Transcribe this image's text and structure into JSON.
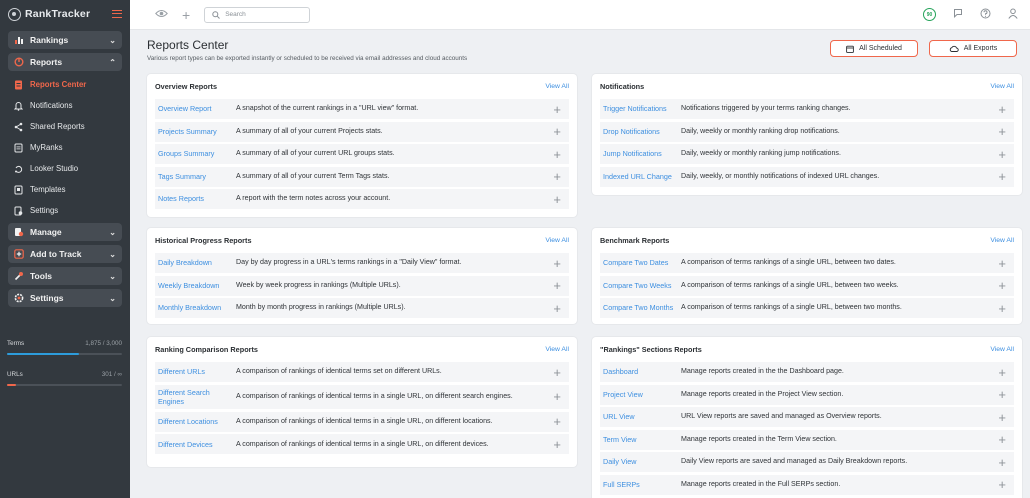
{
  "app": {
    "name": "RankTracker"
  },
  "sidebar": {
    "rankings": "Rankings",
    "reports": "Reports",
    "reports_items": [
      {
        "label": "Reports Center",
        "icon": "file-report-icon"
      },
      {
        "label": "Notifications",
        "icon": "bell-icon"
      },
      {
        "label": "Shared Reports",
        "icon": "share-icon"
      },
      {
        "label": "MyRanks",
        "icon": "document-icon"
      },
      {
        "label": "Looker Studio",
        "icon": "looker-icon"
      },
      {
        "label": "Templates",
        "icon": "template-icon"
      },
      {
        "label": "Settings",
        "icon": "settings-doc-icon"
      }
    ],
    "manage": "Manage",
    "add_to_track": "Add to Track",
    "tools": "Tools",
    "settings": "Settings"
  },
  "usage": {
    "terms_label": "Terms",
    "terms_value": "1,875 / 3,000",
    "terms_fraction": 0.625,
    "urls_label": "URLs",
    "urls_value": "301 / ∞",
    "urls_fraction": 0.08
  },
  "topbar": {
    "search_placeholder": "Search",
    "badge": "90"
  },
  "header": {
    "title": "Reports Center",
    "subtitle": "Various report types can be exported instantly or scheduled to be received via email addresses and cloud accounts",
    "all_scheduled": "All Scheduled",
    "all_exports": "All Exports"
  },
  "view_all": "View All",
  "cards": {
    "overview": {
      "title": "Overview Reports",
      "rows": [
        {
          "name": "Overview Report",
          "desc": "A snapshot of the current rankings in a \"URL view\" format."
        },
        {
          "name": "Projects Summary",
          "desc": "A summary of all of your current Projects stats."
        },
        {
          "name": "Groups Summary",
          "desc": "A summary of all of your current URL groups stats."
        },
        {
          "name": "Tags Summary",
          "desc": "A summary of all of your current Term Tags stats."
        },
        {
          "name": "Notes Reports",
          "desc": "A report with the term notes across your account."
        }
      ]
    },
    "notifications": {
      "title": "Notifications",
      "rows": [
        {
          "name": "Trigger Notifications",
          "desc": "Notifications triggered by your terms ranking changes."
        },
        {
          "name": "Drop Notifications",
          "desc": "Daily, weekly or monthly ranking drop notifications."
        },
        {
          "name": "Jump Notifications",
          "desc": "Daily, weekly or monthly ranking jump notifications."
        },
        {
          "name": "Indexed URL Change",
          "desc": "Daily, weekly, or monthly notifications of indexed URL changes."
        }
      ]
    },
    "historical": {
      "title": "Historical Progress Reports",
      "rows": [
        {
          "name": "Daily Breakdown",
          "desc": "Day by day progress in a URL's terms rankings in a \"Daily View\" format."
        },
        {
          "name": "Weekly Breakdown",
          "desc": "Week by week progress in rankings (Multiple URLs)."
        },
        {
          "name": "Monthly Breakdown",
          "desc": "Month by month progress in rankings (Multiple URLs)."
        }
      ]
    },
    "benchmark": {
      "title": "Benchmark Reports",
      "rows": [
        {
          "name": "Compare Two Dates",
          "desc": "A comparison of terms rankings of a single URL, between two dates."
        },
        {
          "name": "Compare Two Weeks",
          "desc": "A comparison of terms rankings of a single URL, between two weeks."
        },
        {
          "name": "Compare Two Months",
          "desc": "A comparison of terms rankings of a single URL, between two months."
        }
      ]
    },
    "ranking_comparison": {
      "title": "Ranking Comparison Reports",
      "rows": [
        {
          "name": "Different URLs",
          "desc": "A comparison of rankings of identical terms set on different URLs."
        },
        {
          "name": "Different Search Engines",
          "desc": "A comparison of rankings of identical terms in a single URL, on different search engines."
        },
        {
          "name": "Different Locations",
          "desc": "A comparison of rankings of identical terms in a single URL, on different locations."
        },
        {
          "name": "Different Devices",
          "desc": "A comparison of rankings of identical terms in a single URL, on different devices."
        }
      ]
    },
    "sections": {
      "title": "\"Rankings\" Sections Reports",
      "rows": [
        {
          "name": "Dashboard",
          "desc": "Manage reports created in the the Dashboard page."
        },
        {
          "name": "Project View",
          "desc": "Manage reports created in the Project View section."
        },
        {
          "name": "URL View",
          "desc": "URL View reports are saved and managed as Overview reports."
        },
        {
          "name": "Term View",
          "desc": "Manage reports created in the Term View section."
        },
        {
          "name": "Daily View",
          "desc": "Daily View reports are saved and managed as Daily Breakdown reports."
        },
        {
          "name": "Full SERPs",
          "desc": "Manage reports created in the Full SERPs section."
        }
      ]
    }
  },
  "colors": {
    "accent": "#f0674b",
    "link": "#3d8fe0",
    "sidebar": "#33393f",
    "terms_bar": "#2d9cdb",
    "urls_bar": "#f0674b"
  }
}
